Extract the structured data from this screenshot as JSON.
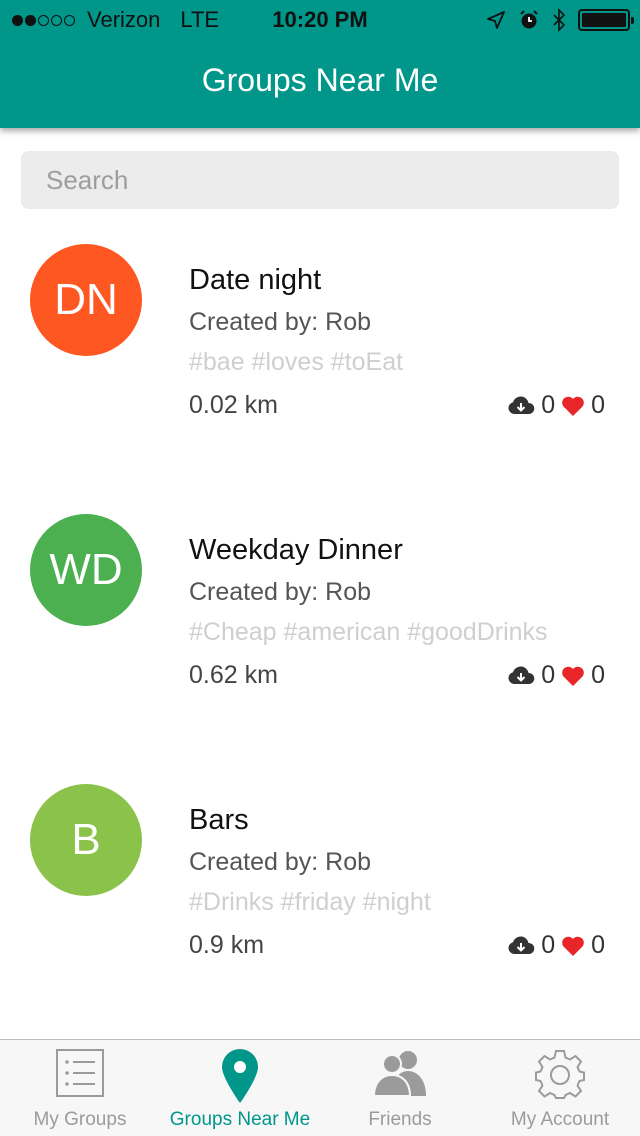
{
  "status_bar": {
    "carrier": "Verizon",
    "network": "LTE",
    "time": "10:20 PM",
    "signal_bars": 2,
    "signal_total": 5,
    "battery_level": 1.0
  },
  "header": {
    "title": "Groups Near Me"
  },
  "search": {
    "placeholder": "Search"
  },
  "groups": [
    {
      "initials": "DN",
      "name": "Date night",
      "creator": "Created by: Rob",
      "tags": "#bae  #loves  #toEat",
      "distance": "0.02 km",
      "downloads": "0",
      "likes": "0",
      "color": "#fe5722"
    },
    {
      "initials": "WD",
      "name": "Weekday Dinner",
      "creator": "Created by: Rob",
      "tags": "#Cheap  #american  #goodDrinks",
      "distance": "0.62 km",
      "downloads": "0",
      "likes": "0",
      "color": "#4caf50"
    },
    {
      "initials": "B",
      "name": "Bars",
      "creator": "Created by: Rob",
      "tags": "#Drinks  #friday  #night",
      "distance": "0.9 km",
      "downloads": "0",
      "likes": "0",
      "color": "#8bc34a"
    }
  ],
  "tabs": [
    {
      "label": "My Groups",
      "icon": "list-icon",
      "active": false
    },
    {
      "label": "Groups Near Me",
      "icon": "location-pin-icon",
      "active": true
    },
    {
      "label": "Friends",
      "icon": "people-icon",
      "active": false
    },
    {
      "label": "My Account",
      "icon": "gear-icon",
      "active": false
    }
  ],
  "colors": {
    "accent": "#00968a",
    "heart": "#e8262a"
  }
}
